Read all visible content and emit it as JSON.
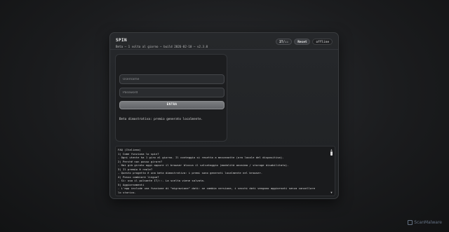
{
  "app": {
    "title": "SPIN",
    "subtitle": "Beta – 1 volta al giorno – build 2026-02-10 – v2.3.0"
  },
  "header_buttons": {
    "language": "IT/::",
    "reset": "Reset",
    "offline": "offline"
  },
  "login": {
    "username_placeholder": "Username",
    "password_placeholder": "Password",
    "enter_label": "ENTRA",
    "demo_note": "Beta dimostrativa: premio generato localmente."
  },
  "faq": {
    "lines": [
      "FAQ (Italiano)",
      "1) Come funziona lo spin?",
      "   - Ogni utente ha 1 giro al giorno. Il conteggio si resetta a mezzanotte (ora locale del dispositivo).",
      "2) Perché non posso girare?",
      "   - Hai già girato oggi oppure il browser blocca il salvataggio (modalità anonima / storage disabilitato).",
      "3) Il premio è reale?",
      "   - Questo progetto è una beta dimostrativa: i premi sono generati localmente nel browser.",
      "4) Posso cambiare lingua?",
      "   - Sì: usa il pulsante IT/::. La scelta viene salvata.",
      "5) Aggiornamenti",
      "   - L'app include una funzione di \"migrazione\" dati: se cambia versione, i vecchi dati vengono aggiornati senza cancellare",
      "lo storico."
    ]
  },
  "watermark": "ScanMalware"
}
